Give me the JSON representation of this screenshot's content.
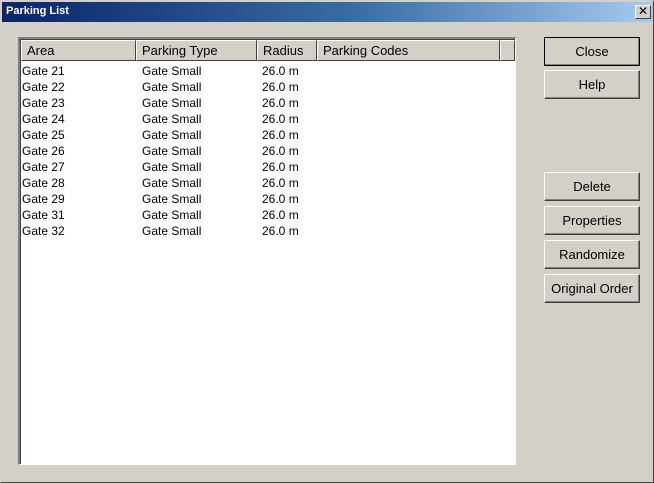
{
  "window": {
    "title": "Parking List",
    "close_glyph": "✕"
  },
  "list": {
    "columns": [
      "Area",
      "Parking Type",
      "Radius",
      "Parking Codes"
    ],
    "rows": [
      {
        "area": "Gate  21",
        "type": "Gate Small",
        "radius": "26.0 m",
        "codes": ""
      },
      {
        "area": "Gate  22",
        "type": "Gate Small",
        "radius": "26.0 m",
        "codes": ""
      },
      {
        "area": "Gate  23",
        "type": "Gate Small",
        "radius": "26.0 m",
        "codes": ""
      },
      {
        "area": "Gate  24",
        "type": "Gate Small",
        "radius": "26.0 m",
        "codes": ""
      },
      {
        "area": "Gate  25",
        "type": "Gate Small",
        "radius": "26.0 m",
        "codes": ""
      },
      {
        "area": "Gate  26",
        "type": "Gate Small",
        "radius": "26.0 m",
        "codes": ""
      },
      {
        "area": "Gate  27",
        "type": "Gate Small",
        "radius": "26.0 m",
        "codes": ""
      },
      {
        "area": "Gate  28",
        "type": "Gate Small",
        "radius": "26.0 m",
        "codes": ""
      },
      {
        "area": "Gate  29",
        "type": "Gate Small",
        "radius": "26.0 m",
        "codes": ""
      },
      {
        "area": "Gate  31",
        "type": "Gate Small",
        "radius": "26.0 m",
        "codes": ""
      },
      {
        "area": "Gate  32",
        "type": "Gate Small",
        "radius": "26.0 m",
        "codes": ""
      }
    ]
  },
  "buttons": {
    "close": "Close",
    "help": "Help",
    "delete": "Delete",
    "properties": "Properties",
    "randomize": "Randomize",
    "original_order": "Original Order"
  },
  "colors": {
    "face": "#d4d0c8",
    "title_start": "#0a246a",
    "title_end": "#a6caf0",
    "list_bg": "#ffffff"
  }
}
